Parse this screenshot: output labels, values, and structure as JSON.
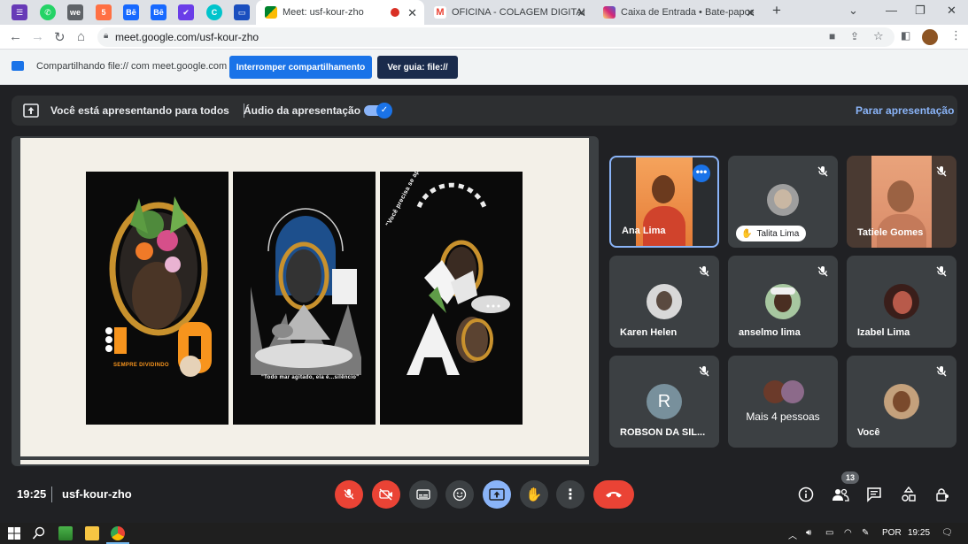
{
  "browser": {
    "pinned_tabs": [
      {
        "icon": "purple-app-icon",
        "color": "#673ab7",
        "glyph": "☰"
      },
      {
        "icon": "whatsapp-icon",
        "color": "#25d366",
        "glyph": "✆"
      },
      {
        "icon": "we-app-icon",
        "color": "#3c4043",
        "glyph": "we"
      },
      {
        "icon": "orange-app-icon",
        "color": "#ff7043",
        "glyph": "5"
      },
      {
        "icon": "behance-icon",
        "color": "#1769ff",
        "glyph": "Bē"
      },
      {
        "icon": "behance-icon",
        "color": "#1769ff",
        "glyph": "Bē"
      },
      {
        "icon": "pocket-icon",
        "color": "#6a3de8",
        "glyph": "✔"
      },
      {
        "icon": "canva-icon",
        "color": "#00c4cc",
        "glyph": "C"
      },
      {
        "icon": "monitor-app-icon",
        "color": "#1a4fbf",
        "glyph": "▭"
      }
    ],
    "tabs": [
      {
        "title": "Meet: usf-kour-zho",
        "active": true
      },
      {
        "title": "OFICINA - COLAGEM DIGITAL - ",
        "active": false
      },
      {
        "title": "Caixa de Entrada • Bate-papos",
        "active": false
      }
    ],
    "url": "meet.google.com/usf-kour-zho"
  },
  "share_bar": {
    "text": "Compartilhando file:// com meet.google.com",
    "stop_label": "Interromper compartilhamento",
    "view_label": "Ver guia: file://"
  },
  "presenting": {
    "text": "Você está apresentando para todos",
    "audio_label": "Áudio da apresentação",
    "audio_on": true,
    "stop_label": "Parar apresentação"
  },
  "slide": {
    "poster_captions": [
      "SEMPRE DIVIDINDO",
      "\"Todo mar agitado, ela é...silêncio\"",
      "\"Você precisa se apaixonar\""
    ]
  },
  "participants": [
    {
      "name": "Ana Lima",
      "video": true,
      "speaking": true,
      "muted": false
    },
    {
      "name": "Talita Lima",
      "video": false,
      "chip": true,
      "muted": true
    },
    {
      "name": "Tatiele Gomes",
      "video": true,
      "muted": true
    },
    {
      "name": "Karen Helen",
      "video": false,
      "muted": true
    },
    {
      "name": "anselmo lima",
      "video": false,
      "muted": true
    },
    {
      "name": "Izabel Lima",
      "video": false,
      "muted": true
    },
    {
      "name": "ROBSON DA SIL...",
      "video": false,
      "initial": "R",
      "muted": true
    },
    {
      "name": "Mais 4 pessoas",
      "video": false,
      "muted": false
    },
    {
      "name": "Você",
      "video": false,
      "muted": true
    }
  ],
  "bottom": {
    "time": "19:25",
    "meeting_code": "usf-kour-zho",
    "people_count": "13"
  },
  "taskbar": {
    "language": "POR",
    "time": "19:25"
  },
  "colors": {
    "meet_bg": "#202124",
    "tile_bg": "#3c4043",
    "accent_blue": "#8ab4f8",
    "end_call_red": "#ea4335"
  }
}
